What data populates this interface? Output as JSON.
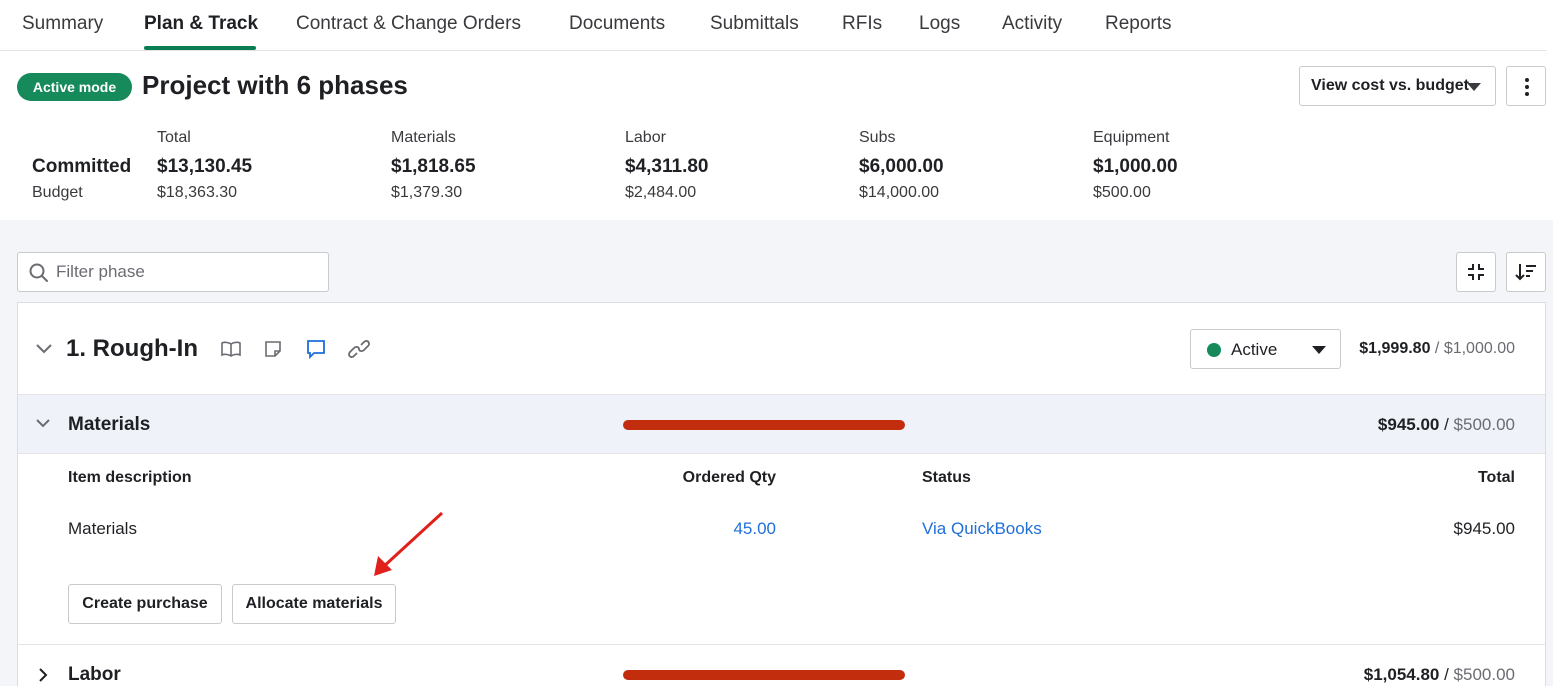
{
  "tabs": [
    {
      "label": "Summary"
    },
    {
      "label": "Plan & Track"
    },
    {
      "label": "Contract & Change Orders"
    },
    {
      "label": "Documents"
    },
    {
      "label": "Submittals"
    },
    {
      "label": "RFIs"
    },
    {
      "label": "Logs"
    },
    {
      "label": "Activity"
    },
    {
      "label": "Reports"
    }
  ],
  "active_tab": "Plan & Track",
  "header": {
    "mode_badge": "Active mode",
    "title": "Project with 6 phases",
    "view_select": "View cost vs. budget"
  },
  "summary": {
    "committed_label": "Committed",
    "budget_label": "Budget",
    "columns": [
      {
        "label": "Total",
        "committed": "$13,130.45",
        "budget": "$18,363.30"
      },
      {
        "label": "Materials",
        "committed": "$1,818.65",
        "budget": "$1,379.30"
      },
      {
        "label": "Labor",
        "committed": "$4,311.80",
        "budget": "$2,484.00"
      },
      {
        "label": "Subs",
        "committed": "$6,000.00",
        "budget": "$14,000.00"
      },
      {
        "label": "Equipment",
        "committed": "$1,000.00",
        "budget": "$500.00"
      }
    ]
  },
  "filter": {
    "placeholder": "Filter phase"
  },
  "phase": {
    "title": "1. Rough-In",
    "status": "Active",
    "committed": "$1,999.80",
    "separator": " / ",
    "budget": "$1,000.00",
    "materials": {
      "title": "Materials",
      "committed": "$945.00",
      "separator": " / ",
      "budget": "$500.00",
      "columns": {
        "description": "Item description",
        "qty": "Ordered Qty",
        "status": "Status",
        "total": "Total"
      },
      "rows": [
        {
          "description": "Materials",
          "qty": "45.00",
          "status": "Via QuickBooks",
          "total": "$945.00"
        }
      ],
      "create_purchase": "Create purchase",
      "allocate_materials": "Allocate materials"
    },
    "labor": {
      "title": "Labor",
      "committed": "$1,054.80",
      "separator": " / ",
      "budget": "$500.00"
    }
  },
  "colors": {
    "accent": "#0a7d52",
    "badge": "#168a5b",
    "over_budget_bar": "#c22d0d",
    "link": "#1e6fd9",
    "annotation_arrow": "#e0201b"
  },
  "icons": [
    "search-icon",
    "collapse-icon",
    "sort-icon",
    "chevron-down-icon",
    "chevron-right-icon",
    "book-icon",
    "note-icon",
    "comment-icon",
    "link-icon",
    "caret-down-icon",
    "kebab-icon"
  ]
}
